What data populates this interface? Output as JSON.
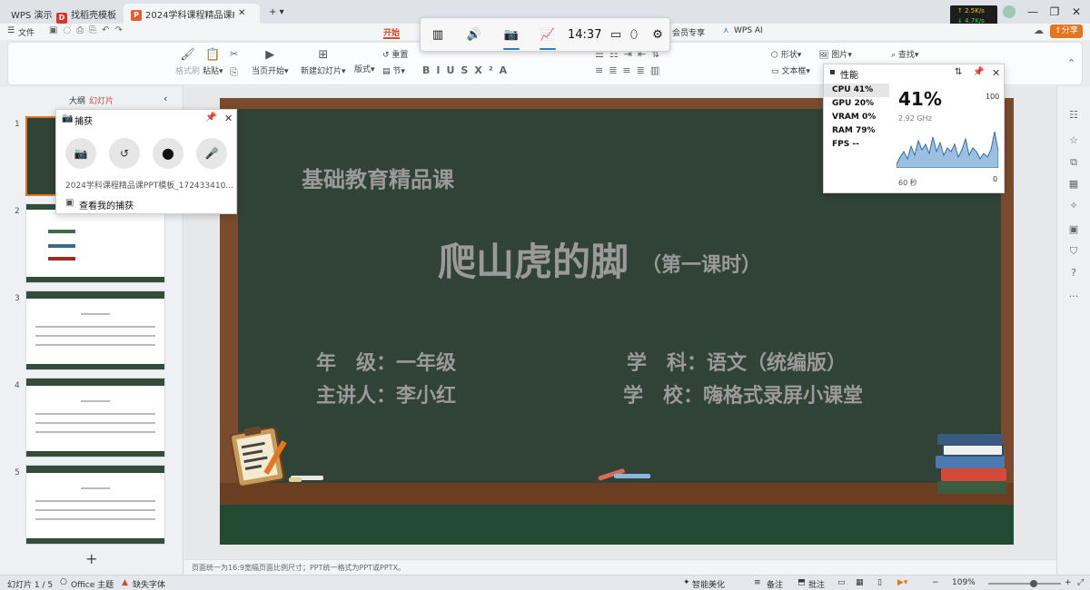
{
  "titlebar": {
    "tabs": [
      {
        "label": "WPS 演示"
      },
      {
        "label": "找稻壳模板"
      },
      {
        "label": "2024学科课程精品课PPT模板"
      }
    ],
    "new_tab": "+",
    "net": {
      "up": "2.5K/s",
      "down": "4.7K/s"
    }
  },
  "menu": {
    "file": "文件",
    "items": [
      "开始",
      "会员专享",
      "WPS AI"
    ],
    "share": "分享"
  },
  "ribbon": {
    "format_painter": "格式刷",
    "paste": "粘贴",
    "play_from_current": "当页开始",
    "new_slide": "新建幻灯片",
    "layout": "版式",
    "section": "节",
    "reset": "重置",
    "shape": "形状",
    "picture": "图片",
    "textbox": "文本框",
    "find": "查找"
  },
  "left_panel": {
    "tab_outline": "大纲",
    "tab_slides": "幻灯片",
    "slide_numbers": [
      "1",
      "2",
      "3",
      "4",
      "5"
    ],
    "add": "+"
  },
  "slide": {
    "subtitle": "基础教育精品课",
    "title": "爬山虎的脚",
    "title_suffix": "（第一课时）",
    "grade": "年　级：一年级",
    "subject": "学　科：语文（统编版）",
    "teacher": "主讲人：李小红",
    "school": "学　校：嗨格式录屏小课堂"
  },
  "notes": "页面统一为16:9宽幅页面比例尺寸；PPT统一格式为PPT或PPTX。",
  "gamebar": {
    "time": "14:37"
  },
  "capture": {
    "title": "捕获",
    "filename": "2024学科课程精品课PPT模板_172433410...",
    "view_link": "查看我的捕获"
  },
  "performance": {
    "title": "性能",
    "rows": [
      {
        "label": "CPU",
        "value": "41%"
      },
      {
        "label": "GPU",
        "value": "20%"
      },
      {
        "label": "VRAM",
        "value": "0%"
      },
      {
        "label": "RAM",
        "value": "79%"
      },
      {
        "label": "FPS",
        "value": "--"
      }
    ],
    "big_value": "41%",
    "freq": "2.92 GHz",
    "max": "100",
    "min": "0",
    "span": "60 秒"
  },
  "statusbar": {
    "slide_info": "幻灯片 1 / 5",
    "theme": "Office 主题",
    "missing_font": "缺失字体",
    "beautify": "智能美化",
    "notes": "备注",
    "comments": "批注",
    "zoom": "109%"
  }
}
